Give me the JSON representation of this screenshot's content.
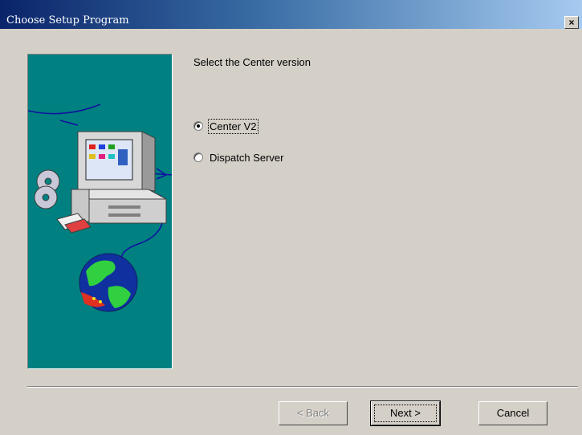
{
  "window": {
    "title": "Choose Setup Program",
    "close_glyph": "×"
  },
  "content": {
    "heading": "Select the Center version",
    "options": [
      {
        "label": "Center V2",
        "selected": true
      },
      {
        "label": "Dispatch Server",
        "selected": false
      }
    ]
  },
  "buttons": {
    "back_label": "< Back",
    "next_label": "Next >",
    "cancel_label": "Cancel"
  },
  "colors": {
    "dialog_bg": "#d4d0c8",
    "titlebar_start": "#0a246a",
    "titlebar_end": "#a6caf0",
    "bitmap_bg": "#008080"
  }
}
